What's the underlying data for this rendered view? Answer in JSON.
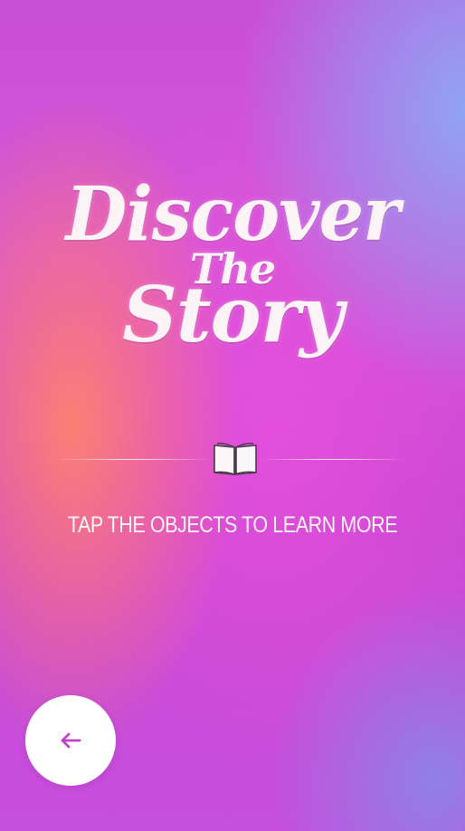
{
  "title": {
    "line1": "Discover",
    "line2": "The",
    "line3": "Story"
  },
  "instruction": "TAP THE OBJECTS TO LEARN MORE",
  "icons": {
    "divider_icon": "open-book-icon",
    "back_icon": "arrow-left-icon"
  },
  "colors": {
    "text": "#fbf3f6",
    "back_button_bg": "#ffffff",
    "back_arrow": "#c243c9"
  }
}
